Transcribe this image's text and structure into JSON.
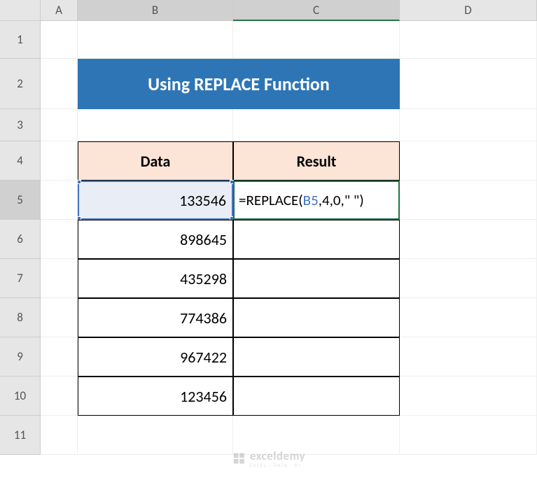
{
  "columns": [
    "A",
    "B",
    "C",
    "D"
  ],
  "rows": [
    "1",
    "2",
    "3",
    "4",
    "5",
    "6",
    "7",
    "8",
    "9",
    "10",
    "11"
  ],
  "title": "Using REPLACE Function",
  "headers": {
    "data": "Data",
    "result": "Result"
  },
  "data_values": [
    "133546",
    "898645",
    "435298",
    "774386",
    "967422",
    "123456"
  ],
  "formula": {
    "eq": "=",
    "fn": "REPLACE",
    "open": "(",
    "ref": "B5",
    "rest": ",4,0,\" \"",
    "close": ")"
  },
  "watermark": {
    "name": "exceldemy",
    "sub": "EXCEL · DATA · BI"
  }
}
